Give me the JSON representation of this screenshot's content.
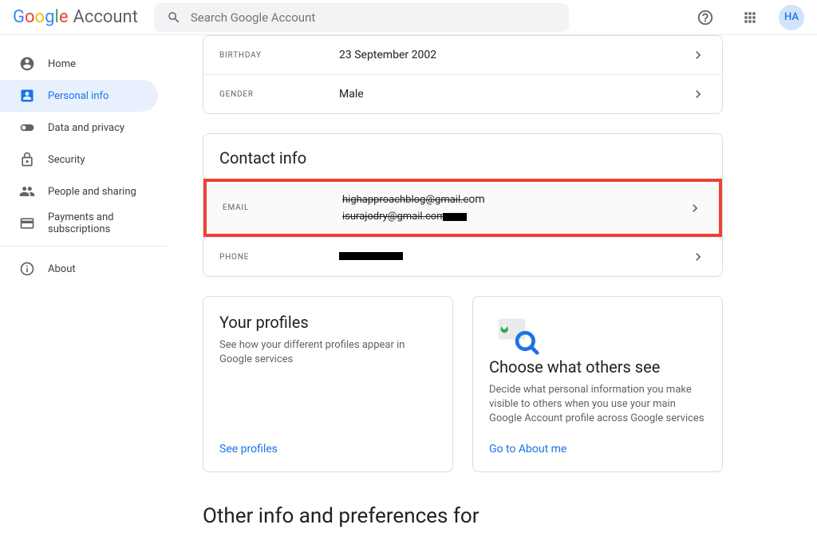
{
  "header": {
    "logo_text": "Google",
    "logo_suffix": "Account",
    "search_placeholder": "Search Google Account",
    "avatar_initials": "HA"
  },
  "sidebar": {
    "items": [
      {
        "label": "Home"
      },
      {
        "label": "Personal info"
      },
      {
        "label": "Data and privacy"
      },
      {
        "label": "Security"
      },
      {
        "label": "People and sharing"
      },
      {
        "label": "Payments and subscriptions"
      },
      {
        "label": "About"
      }
    ]
  },
  "basic_info": {
    "birthday_label": "BIRTHDAY",
    "birthday_value": "23 September 2002",
    "gender_label": "GENDER",
    "gender_value": "Male"
  },
  "contact_info": {
    "title": "Contact info",
    "email_label": "EMAIL",
    "email_value1_visible": "om",
    "phone_label": "PHONE"
  },
  "profiles": {
    "your_title": "Your profiles",
    "your_desc": "See how your different profiles appear in Google services",
    "your_link": "See profiles",
    "others_title": "Choose what others see",
    "others_desc": "Decide what personal information you make visible to others when you use your main Google Account profile across Google services",
    "others_link": "Go to About me"
  },
  "bottom": {
    "heading": "Other info and preferences for"
  }
}
